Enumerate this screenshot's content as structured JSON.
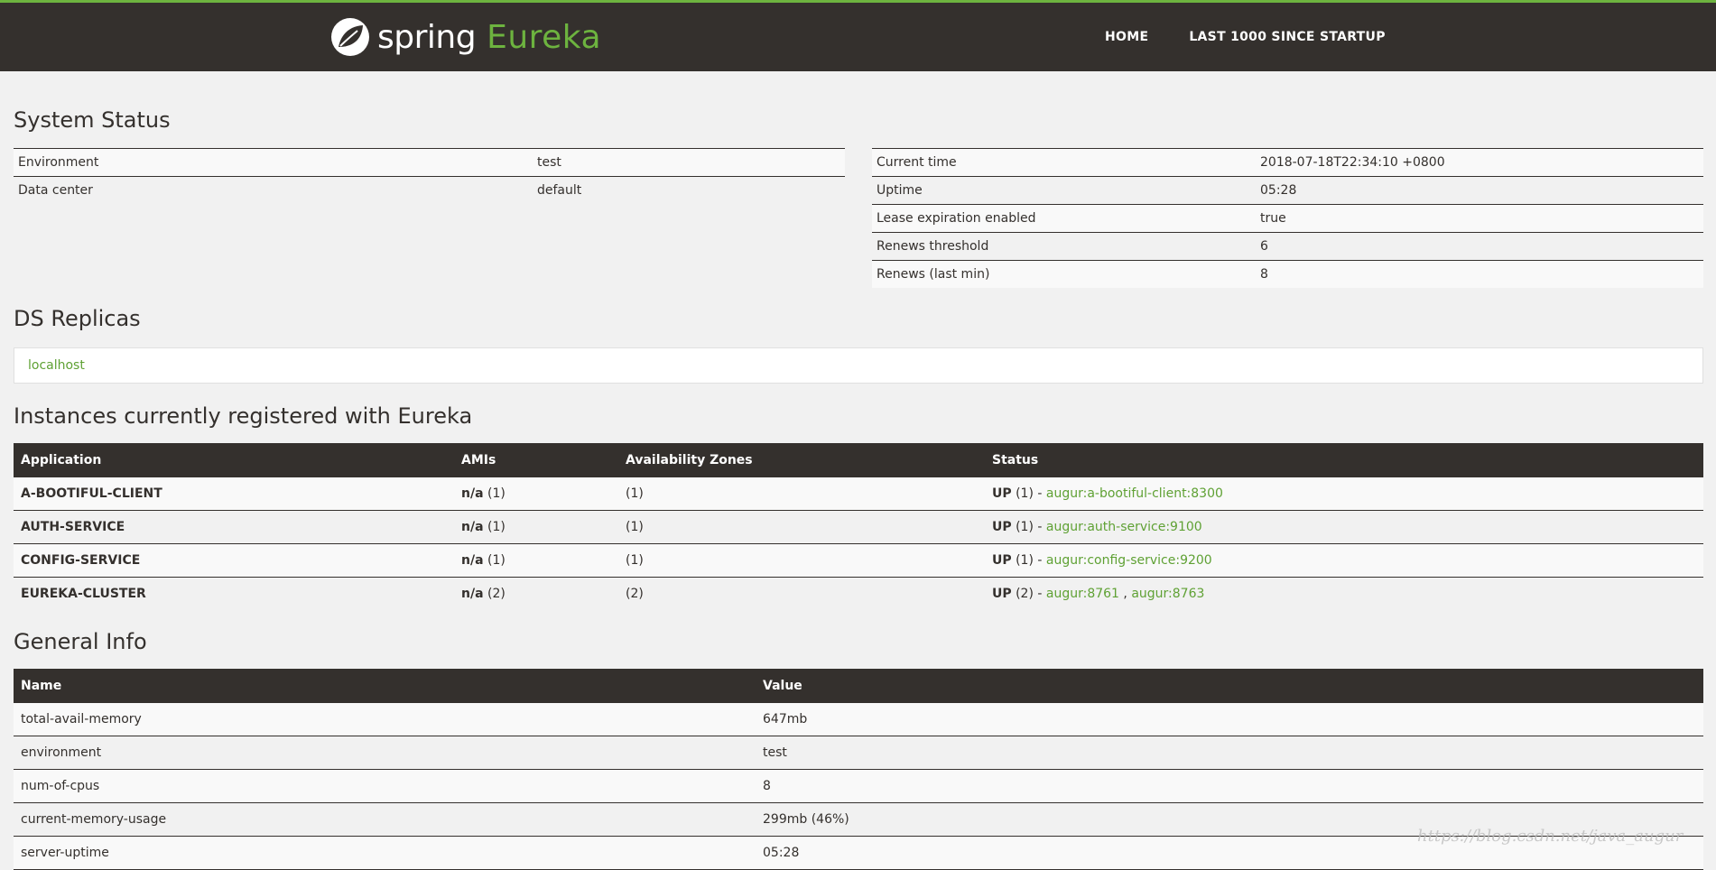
{
  "header": {
    "brand_spring": "spring",
    "brand_eureka": "Eureka",
    "nav": {
      "home": "HOME",
      "last1000": "LAST 1000 SINCE STARTUP"
    },
    "colors": {
      "bar": "#34302d",
      "accent": "#6db33f"
    }
  },
  "system_status": {
    "title": "System Status",
    "left": [
      {
        "k": "Environment",
        "v": "test"
      },
      {
        "k": "Data center",
        "v": "default"
      }
    ],
    "right": [
      {
        "k": "Current time",
        "v": "2018-07-18T22:34:10 +0800"
      },
      {
        "k": "Uptime",
        "v": "05:28"
      },
      {
        "k": "Lease expiration enabled",
        "v": "true"
      },
      {
        "k": "Renews threshold",
        "v": "6"
      },
      {
        "k": "Renews (last min)",
        "v": "8"
      }
    ]
  },
  "ds_replicas": {
    "title": "DS Replicas",
    "items": [
      "localhost"
    ]
  },
  "instances": {
    "title": "Instances currently registered with Eureka",
    "headers": [
      "Application",
      "AMIs",
      "Availability Zones",
      "Status"
    ],
    "rows": [
      {
        "app": "A-BOOTIFUL-CLIENT",
        "ami": "n/a",
        "ami_count": "(1)",
        "zones": "(1)",
        "status": "UP",
        "status_count": "(1) -",
        "links": [
          "augur:a-bootiful-client:8300"
        ]
      },
      {
        "app": "AUTH-SERVICE",
        "ami": "n/a",
        "ami_count": "(1)",
        "zones": "(1)",
        "status": "UP",
        "status_count": "(1) -",
        "links": [
          "augur:auth-service:9100"
        ]
      },
      {
        "app": "CONFIG-SERVICE",
        "ami": "n/a",
        "ami_count": "(1)",
        "zones": "(1)",
        "status": "UP",
        "status_count": "(1) -",
        "links": [
          "augur:config-service:9200"
        ]
      },
      {
        "app": "EUREKA-CLUSTER",
        "ami": "n/a",
        "ami_count": "(2)",
        "zones": "(2)",
        "status": "UP",
        "status_count": "(2) -",
        "links": [
          "augur:8761",
          "augur:8763"
        ]
      }
    ]
  },
  "general_info": {
    "title": "General Info",
    "headers": [
      "Name",
      "Value"
    ],
    "rows": [
      {
        "name": "total-avail-memory",
        "value": "647mb"
      },
      {
        "name": "environment",
        "value": "test"
      },
      {
        "name": "num-of-cpus",
        "value": "8"
      },
      {
        "name": "current-memory-usage",
        "value": "299mb (46%)"
      },
      {
        "name": "server-uptime",
        "value": "05:28"
      }
    ]
  },
  "watermark": "https://blog.csdn.net/java_augur"
}
